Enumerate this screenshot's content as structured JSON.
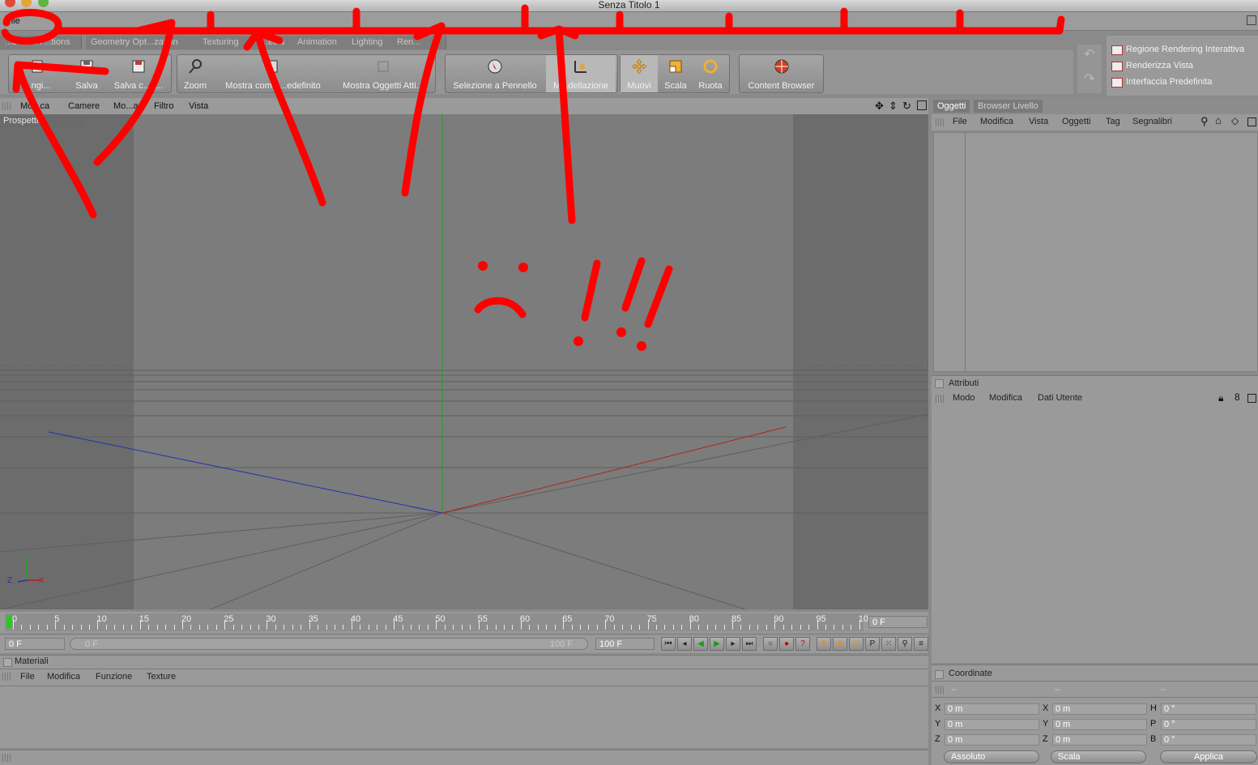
{
  "window": {
    "title": "Senza Titolo 1"
  },
  "menubar": {
    "file": "File"
  },
  "layout_tabs": [
    "...eneral F...tions",
    "Geometry Opt...zation",
    "Texturing",
    "...ects",
    "Animation",
    "Lighting",
    "Ren..."
  ],
  "toolbar": {
    "buttons": [
      {
        "label": "...ngi...",
        "icon": "add-icon"
      },
      {
        "label": "Salva",
        "icon": "save-icon"
      },
      {
        "label": "Salva c...e...",
        "icon": "save-as-icon"
      },
      {
        "label": "Zoom",
        "icon": "zoom-icon"
      },
      {
        "label": "Mostra come ...edefinito",
        "icon": "default-view-icon"
      },
      {
        "label": "Mostra Oggetti Atti...",
        "icon": "active-objects-icon"
      },
      {
        "label": "Selezione a Pennello",
        "icon": "brush-select-icon"
      },
      {
        "label": "M...dellazione",
        "icon": "modeling-icon"
      },
      {
        "label": "Muovi",
        "icon": "move-icon"
      },
      {
        "label": "Scala",
        "icon": "scale-icon"
      },
      {
        "label": "Ruota",
        "icon": "rotate-icon"
      },
      {
        "label": "Content Browser",
        "icon": "content-browser-icon"
      }
    ]
  },
  "render_panel": {
    "items": [
      "Regione Rendering Interattiva",
      "Renderizza Vista",
      "Interfaccia Predefinita"
    ]
  },
  "viewport": {
    "menu": [
      "Mo...ca",
      "Camere",
      "Mo...a",
      "Filtro",
      "Vista"
    ],
    "label": "Prospetti..."
  },
  "timeline": {
    "ticks": [
      "0",
      "5",
      "10",
      "15",
      "20",
      "25",
      "30",
      "35",
      "40",
      "45",
      "50",
      "55",
      "60",
      "65",
      "70",
      "75",
      "80",
      "85",
      "90",
      "95",
      "10"
    ],
    "current_frame": "0 F",
    "start_frame": "0 F",
    "range_start": "0 F",
    "range_end": "100 F",
    "end_frame": "100 F"
  },
  "materials": {
    "title": "Materiali",
    "menu": [
      "File",
      "Modifica",
      "Funzione",
      "Texture"
    ]
  },
  "objects": {
    "tabs": [
      "Oggetti",
      "Browser Livello"
    ],
    "menu": [
      "File",
      "Modifica",
      "Vista",
      "Oggetti",
      "Tag",
      "Segnalibri"
    ]
  },
  "attributes": {
    "title": "Attributi",
    "menu": [
      "Modo",
      "Modifica",
      "Dati Utente"
    ]
  },
  "coordinates": {
    "title": "Coordinate",
    "cols": [
      "--",
      "--",
      "--"
    ],
    "rows": [
      {
        "a": "X",
        "av": "0 m",
        "b": "X",
        "bv": "0 m",
        "c": "H",
        "cv": "0 °"
      },
      {
        "a": "Y",
        "av": "0 m",
        "b": "Y",
        "bv": "0 m",
        "c": "P",
        "cv": "0 °"
      },
      {
        "a": "Z",
        "av": "0 m",
        "b": "Z",
        "bv": "0 m",
        "c": "B",
        "cv": "0 °"
      }
    ],
    "mode": "Assoluto",
    "scale": "Scala",
    "apply": "Applica"
  },
  "axis_gizmo": {
    "y": "Y",
    "z": "Z",
    "x": "X"
  },
  "colors": {
    "annotation": "#ff0000",
    "x_axis": "#b02020",
    "z_axis": "#2030b0",
    "y_axis": "#20a020"
  }
}
